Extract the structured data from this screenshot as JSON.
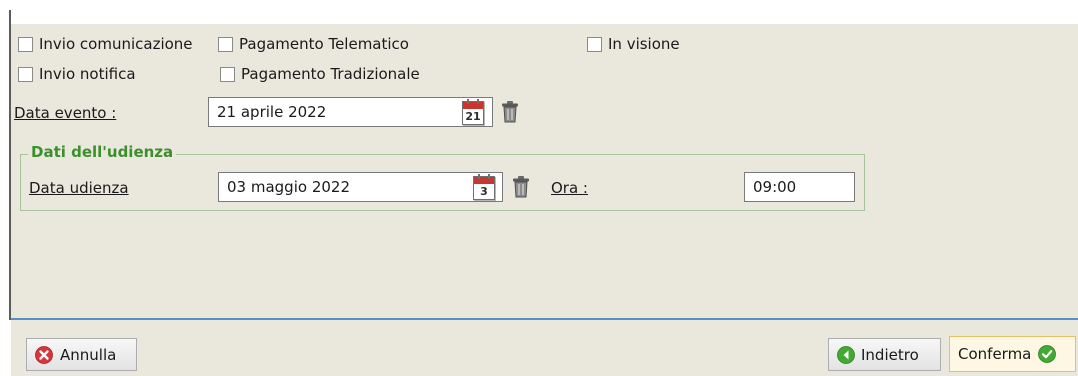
{
  "checkboxes": {
    "invio_comunicazione": "Invio comunicazione",
    "pagamento_telematico": "Pagamento Telematico",
    "in_visione": "In visione",
    "invio_notifica": "Invio notifica",
    "pagamento_tradizionale": "Pagamento Tradizionale"
  },
  "data_evento": {
    "label": "Data evento :",
    "value": "21 aprile 2022",
    "calendar_day": "21"
  },
  "udienza_group": {
    "title": "Dati dell'udienza",
    "data_udienza_label": "Data udienza",
    "data_udienza_value": "03 maggio 2022",
    "calendar_day": "3",
    "ora_label": "Ora :",
    "ora_value": "09:00"
  },
  "footer": {
    "annulla_label": "Annulla",
    "indietro_label": "Indietro",
    "conferma_label": "Conferma"
  },
  "icons": {
    "annulla": "cancel-icon",
    "indietro": "back-arrow-icon",
    "conferma": "checkmark-icon",
    "calendar": "calendar-icon",
    "trash": "trash-icon"
  },
  "colors": {
    "panel_background": "#eae8dd",
    "group_title": "#3c8f2c",
    "separator": "#5b8ec6",
    "cancel_red": "#d8343a",
    "ok_green": "#43a933"
  }
}
